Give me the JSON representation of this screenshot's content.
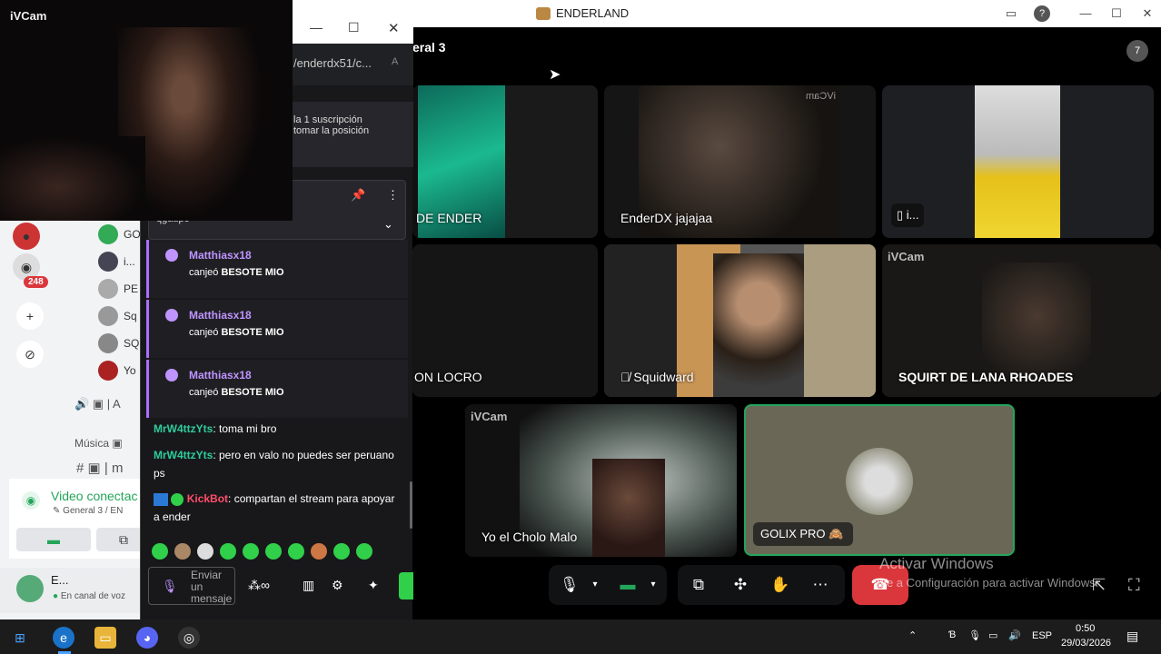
{
  "window": {
    "title": "ENDERLAND",
    "members_count": "7"
  },
  "channel": {
    "title": "eral 3"
  },
  "ivcam_preview": {
    "label": "iVCam"
  },
  "tiles": [
    {
      "label": "DE ENDER"
    },
    {
      "label": "EnderDX jajajaa",
      "watermark": "iVCam"
    },
    {
      "label": "i..."
    },
    {
      "label": "ON LOCRO"
    },
    {
      "label": "Squidward"
    },
    {
      "label": "SQUIRT DE LANA RHOADES",
      "watermark": "iVCam"
    },
    {
      "label": "Yo el Cholo Malo",
      "watermark": "iVCam"
    },
    {
      "label": "GOLIX PRO"
    }
  ],
  "sidebar": {
    "badge": "248",
    "voice_users": [
      "GO",
      "i...",
      "PE",
      "Sq",
      "SQ",
      "Yo"
    ],
    "category": "Música",
    "channel_prefix": "A",
    "text_channel": "m",
    "voice_status": "Video conectac",
    "voice_location": "General 3 / EN",
    "user_name": "E...",
    "user_status": "En canal de voz"
  },
  "popup": {
    "url": "/enderdx51/c...",
    "info_line1": "la 1 suscripción",
    "info_line2": "tomar la posición",
    "pinned_text": "qgaupo",
    "redeems": [
      {
        "user": "Matthiasx18",
        "action": "canjeó",
        "reward": "BESOTE MIO"
      },
      {
        "user": "Matthiasx18",
        "action": "canjeó",
        "reward": "BESOTE MIO"
      },
      {
        "user": "Matthiasx18",
        "action": "canjeó",
        "reward": "BESOTE MIO"
      }
    ],
    "chat": [
      {
        "user": "MrW4ttzYts",
        "text": ": toma mi bro"
      },
      {
        "user": "MrW4ttzYts",
        "text": ": pero en valo no puedes ser peruano ps"
      },
      {
        "user": "KickBot",
        "text": ": compartan el stream para apoyar a ender"
      }
    ],
    "send_placeholder": "Enviar un mensaje"
  },
  "watermark": {
    "line1": "Activar Windows",
    "line2": "Ve a Configuración para activar Windows."
  },
  "taskbar": {
    "lang": "ESP",
    "time": "0:50",
    "date": "29/03/2026"
  },
  "colors": {
    "accent_purple": "#bf94ff",
    "hangup": "#da373c",
    "video_green": "#23a55a"
  }
}
